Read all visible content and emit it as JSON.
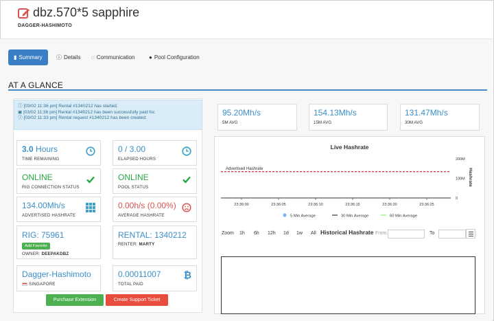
{
  "header": {
    "title": "dbz.570*5 sapphire",
    "subtitle": "DAGGER-HASHIMOTO"
  },
  "tabs": [
    {
      "label": "Summary",
      "icon": "bar-chart-icon"
    },
    {
      "label": "Details",
      "icon": "info-icon"
    },
    {
      "label": "Communication",
      "icon": "chat-icon"
    },
    {
      "label": "Pool Configuration",
      "icon": "drop-icon"
    }
  ],
  "section_title": "AT A GLANCE",
  "notices": [
    "[03/02 11:36 pm] Rental #1340212 has started.",
    "[03/02 11:36 pm] Rental #1340212 has been successfully paid for.",
    "[03/02 11:33 pm] Rental request #1340212 has been created."
  ],
  "cards": {
    "time_remaining": {
      "value_num": "3.0",
      "value_unit": "Hours",
      "label": "TIME REMAINING"
    },
    "elapsed_hours": {
      "value": "0 / 3.00",
      "label": "ELAPSED HOURS"
    },
    "rig_status": {
      "value": "ONLINE",
      "label": "RIG CONNECTION STATUS"
    },
    "pool_status": {
      "value": "ONLINE",
      "label": "POOL STATUS"
    },
    "advertised_hashrate": {
      "value": "134.00Mh/s",
      "label": "ADVERTISED HASHRATE"
    },
    "average_hashrate": {
      "value": "0.00h/s (0.00%)",
      "label": "AVERAGE HASHRATE"
    },
    "rig": {
      "value": "RIG: 75961",
      "add_favorite": "Add Favorite",
      "owner_label": "OWNER:",
      "owner": "DEEPAKDBZ"
    },
    "rental": {
      "value": "RENTAL: 1340212",
      "renter_label": "RENTER:",
      "renter": "MARTY"
    },
    "pool": {
      "value": "Dagger-Hashimoto",
      "location": "SINGAPORE"
    },
    "total_paid": {
      "value": "0.00011007",
      "label": "TOTAL PAID"
    }
  },
  "buttons": {
    "purchase_extension": "Purchase Extension",
    "create_ticket": "Create Support Ticket"
  },
  "averages": [
    {
      "value": "95.20Mh/s",
      "label": "5M AVG"
    },
    {
      "value": "154.13Mh/s",
      "label": "15M AVG"
    },
    {
      "value": "131.47Mh/s",
      "label": "30M AVG"
    }
  ],
  "colors": {
    "accent": "#3a7ec5",
    "value_blue": "#3a8fc8",
    "online_green": "#27a844",
    "error_red": "#d9534f",
    "advertised_line": "#cc0000"
  },
  "chart_data": {
    "type": "line",
    "title": "Live Hashrate",
    "ylabel": "Hashrate",
    "yticks": [
      "200M",
      "100M",
      "0"
    ],
    "ylim": [
      0,
      200
    ],
    "x_ticks": [
      "23:36:00",
      "23:36:05",
      "23:36:10",
      "23:36:15",
      "23:36:20",
      "23:36:25"
    ],
    "annotations": [
      {
        "label": "Advertised Hashrate",
        "y": 134
      }
    ],
    "legend": [
      "5 Min Average",
      "30 Min Average",
      "60 Min Average"
    ],
    "legend_colors": [
      "#7cb5ec",
      "#434348",
      "#90ed7d"
    ],
    "legend_position": "bottom"
  },
  "historical": {
    "title": "Historical Hashrate",
    "zoom_label": "Zoom",
    "zoom_options": [
      "1h",
      "6h",
      "12h",
      "1d",
      "1w",
      "All"
    ],
    "from_label": "From",
    "to_label": "To",
    "menu_icon": "hamburger-icon"
  }
}
